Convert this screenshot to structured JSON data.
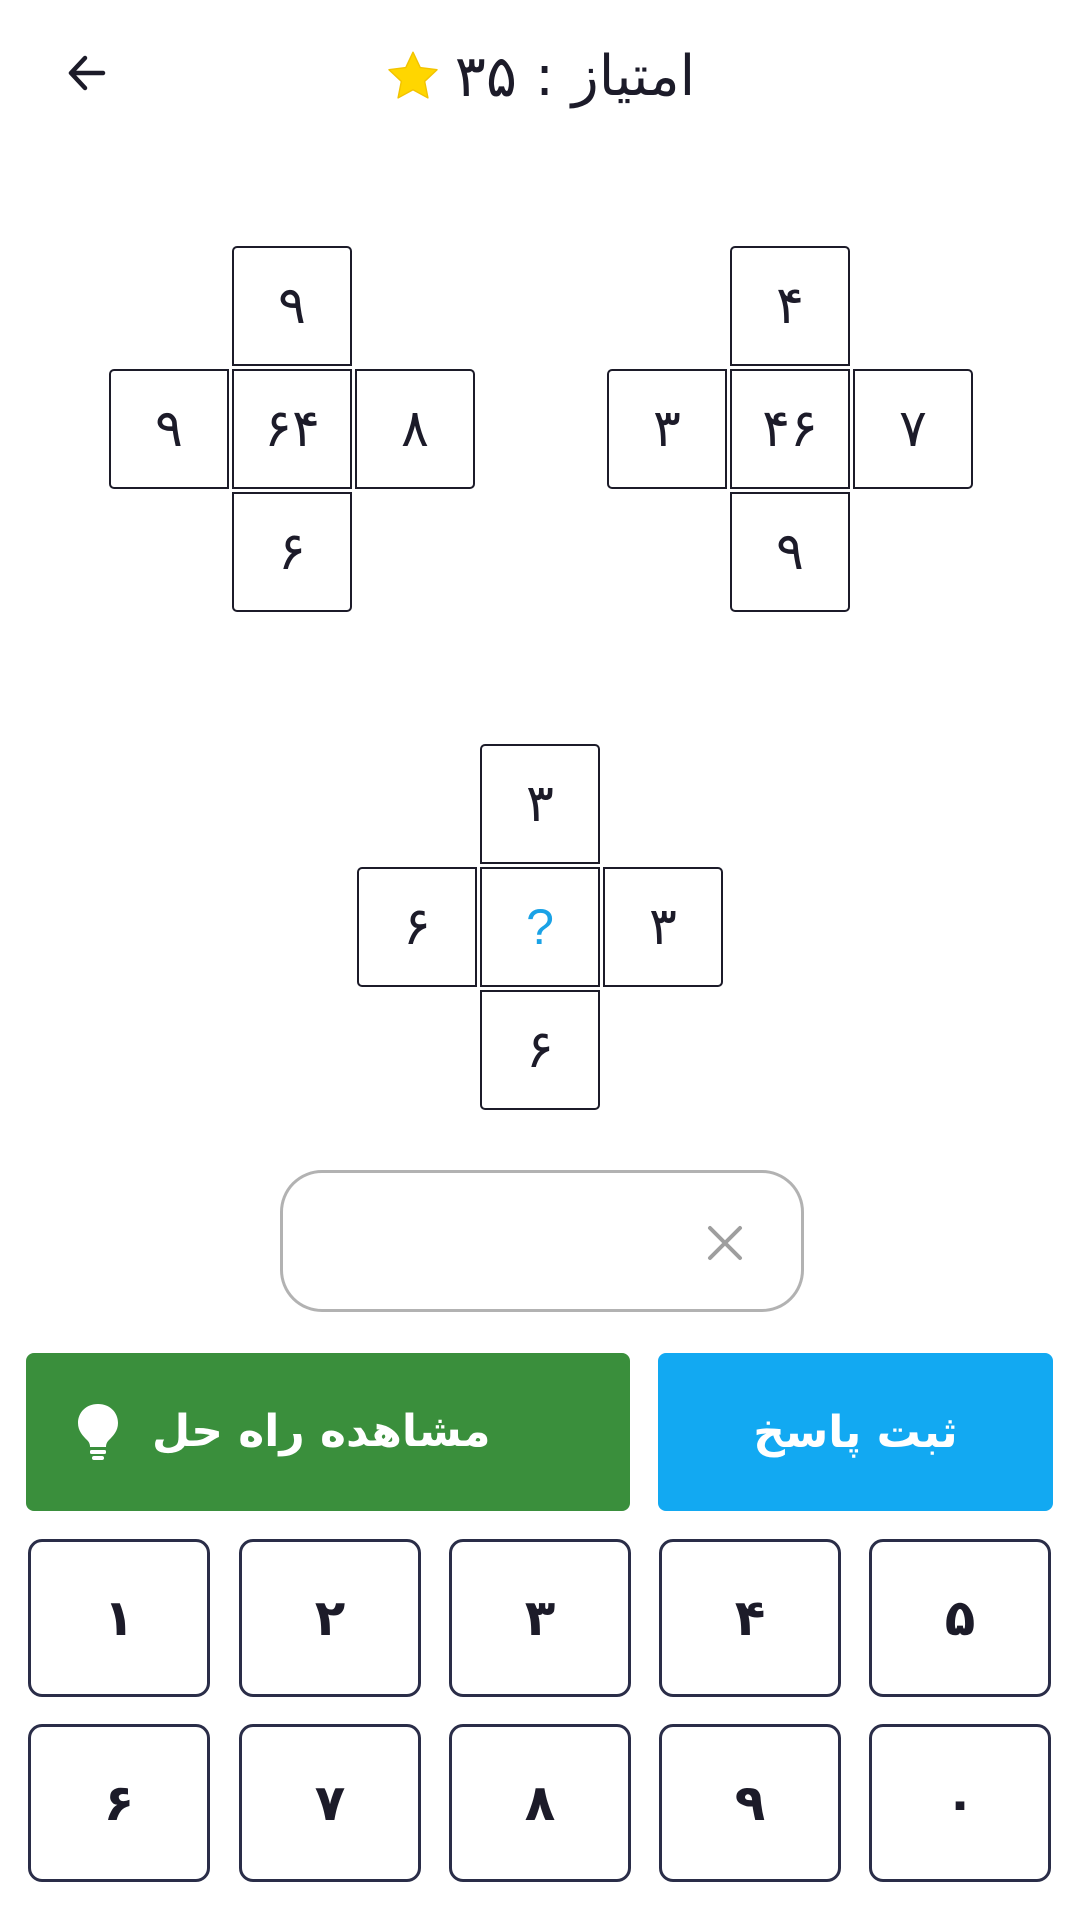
{
  "header": {
    "score_label": "امتیاز :",
    "score_value": "۳۵",
    "back_icon": "arrow-left-icon",
    "star_icon": "star-icon",
    "star_color": "#ffd600"
  },
  "puzzles": [
    {
      "top": "۹",
      "left": "۹",
      "center": "۶۴",
      "right": "۸",
      "bottom": "۶"
    },
    {
      "top": "۴",
      "left": "۳",
      "center": "۴۶",
      "right": "۷",
      "bottom": "۹"
    },
    {
      "top": "۳",
      "left": "۶",
      "center": "?",
      "right": "۳",
      "bottom": "۶"
    }
  ],
  "answer": {
    "value": "",
    "placeholder": "",
    "clear_icon": "close-icon"
  },
  "buttons": {
    "solution_label": "مشاهده راه حل",
    "solution_icon": "lightbulb-icon",
    "solution_color": "#3a8f3c",
    "submit_label": "ثبت پاسخ",
    "submit_color": "#12a9f2"
  },
  "keypad": {
    "row1": [
      "۱",
      "۲",
      "۳",
      "۴",
      "۵"
    ],
    "row2": [
      "۶",
      "۷",
      "۸",
      "۹",
      "۰"
    ]
  },
  "colors": {
    "question_mark": "#1aa2e6",
    "cell_border": "#1c1b29"
  }
}
